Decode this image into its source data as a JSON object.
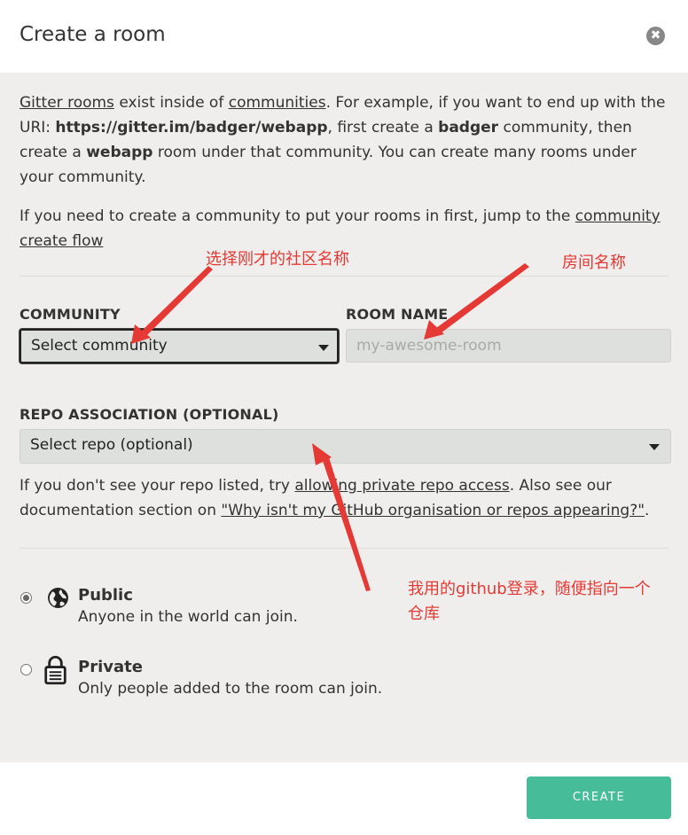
{
  "dialog": {
    "title": "Create a room",
    "close_label": "✖"
  },
  "intro": {
    "link_gitter_rooms": "Gitter rooms",
    "text_1": " exist inside of ",
    "link_communities": "communities",
    "text_2": ". For example, if you want to end up with the URI: ",
    "uri": "https://gitter.im/badger/webapp",
    "text_3": ", first create a ",
    "badger": "badger",
    "text_4": " community, then create a ",
    "webapp": "webapp",
    "text_5": " room under that community. You can create many rooms under your community."
  },
  "flow": {
    "text": "If you need to create a community to put your rooms in first, jump to the ",
    "link": "community create flow"
  },
  "community": {
    "label": "COMMUNITY",
    "selected": "Select community"
  },
  "room_name": {
    "label": "ROOM NAME",
    "placeholder": "my-awesome-room"
  },
  "repo": {
    "label": "REPO ASSOCIATION (OPTIONAL)",
    "selected": "Select repo (optional)",
    "help_1": "If you don't see your repo listed, try ",
    "help_link_1": "allowing private repo access",
    "help_2": ". Also see our documentation section on ",
    "help_link_2": "\"Why isn't my GitHub organisation or repos appearing?\"",
    "help_3": "."
  },
  "visibility": {
    "public_title": "Public",
    "public_desc": "Anyone in the world can join.",
    "private_title": "Private",
    "private_desc": "Only people added to the room can join."
  },
  "annotations": {
    "community_note": "选择刚才的社区名称",
    "room_note": "房间名称",
    "repo_note_line1": "我用的github登录，随便指向一个",
    "repo_note_line2": "仓库"
  },
  "footer": {
    "create_label": "CREATE"
  },
  "colors": {
    "accent": "#46bc99",
    "annotation": "#e53935"
  }
}
